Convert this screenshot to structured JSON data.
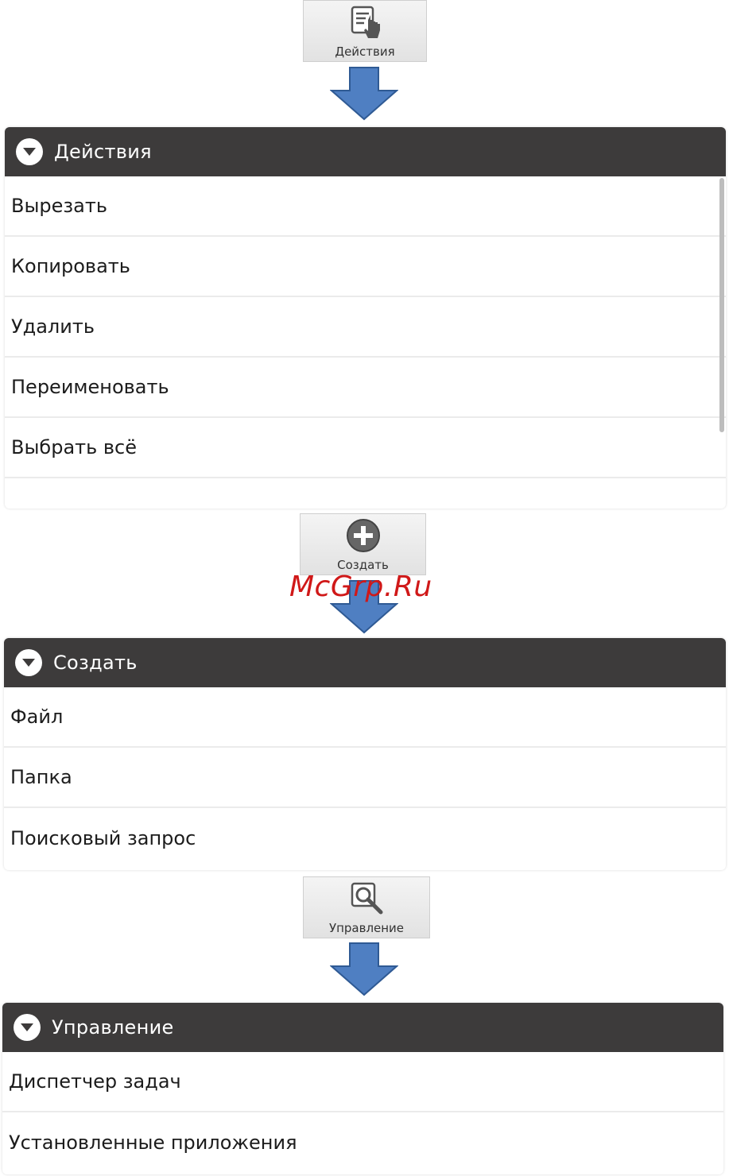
{
  "actions_button": {
    "label": "Действия",
    "icon": "document-touch-icon"
  },
  "actions_menu": {
    "title": "Действия",
    "items": [
      "Вырезать",
      "Копировать",
      "Удалить",
      "Переименовать",
      "Выбрать всё"
    ]
  },
  "create_button": {
    "label": "Создать",
    "icon": "plus-circle-icon"
  },
  "create_menu": {
    "title": "Создать",
    "items": [
      "Файл",
      "Папка",
      "Поисковый запрос"
    ]
  },
  "manage_button": {
    "label": "Управление",
    "icon": "wrench-magnifier-icon"
  },
  "manage_menu": {
    "title": "Управление",
    "items": [
      "Диспетчер задач",
      "Установленные приложения"
    ]
  },
  "watermark": "McGrp.Ru",
  "colors": {
    "header": "#3d3b3b",
    "arrow": "#4f7fc2",
    "watermark": "#d01818"
  }
}
